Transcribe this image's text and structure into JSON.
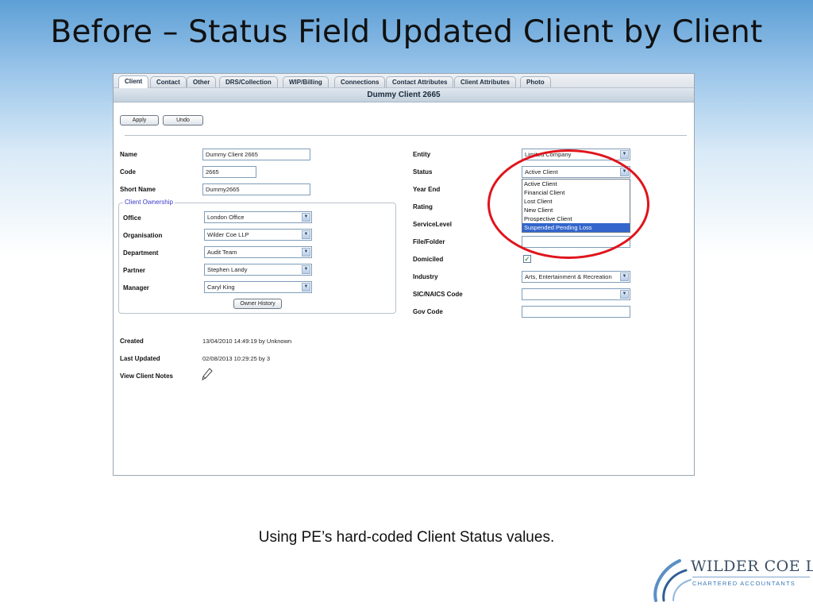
{
  "slide": {
    "title": "Before – Status Field Updated Client by Client",
    "caption": "Using PE’s hard-coded Client Status values."
  },
  "tabs": [
    "Client",
    "Contact",
    "Other",
    "DRS/Collection",
    "WIP/Billing",
    "Connections",
    "Contact Attributes",
    "Client Attributes",
    "Photo"
  ],
  "header": {
    "client_name": "Dummy Client 2665"
  },
  "toolbar": {
    "apply_label": "Apply",
    "undo_label": "Undo"
  },
  "left": {
    "name_label": "Name",
    "name_value": "Dummy Client 2665",
    "code_label": "Code",
    "code_value": "2665",
    "short_name_label": "Short Name",
    "short_name_value": "Dummy2665",
    "ownership_legend": "Client Ownership",
    "office_label": "Office",
    "office_value": "London Office",
    "organisation_label": "Organisation",
    "organisation_value": "Wilder Coe LLP",
    "department_label": "Department",
    "department_value": "Audit Team",
    "partner_label": "Partner",
    "partner_value": "Stephen Landy",
    "manager_label": "Manager",
    "manager_value": "Caryl King",
    "owner_history_label": "Owner History",
    "created_label": "Created",
    "created_value": "13/04/2010 14:49:19 by Unknown",
    "last_updated_label": "Last Updated",
    "last_updated_value": "02/08/2013 10:29:25 by 3",
    "view_notes_label": "View Client Notes"
  },
  "right": {
    "entity_label": "Entity",
    "entity_value": "Limited Company",
    "status_label": "Status",
    "status_value": "Active Client",
    "status_options": [
      "Active Client",
      "Financial Client",
      "Lost Client",
      "New Client",
      "Prospective Client",
      "Suspended Pending Loss"
    ],
    "year_end_label": "Year End",
    "rating_label": "Rating",
    "service_level_label": "ServiceLevel",
    "file_folder_label": "File/Folder",
    "domiciled_label": "Domiciled",
    "domiciled_checked": true,
    "industry_label": "Industry",
    "industry_value": "Arts, Entertainment & Recreation",
    "sic_label": "SIC/NAICS Code",
    "sic_value": "",
    "gov_code_label": "Gov Code",
    "gov_code_value": ""
  },
  "logo": {
    "name": "WILDER COE LLP",
    "tagline": "CHARTERED ACCOUNTANTS"
  },
  "colors": {
    "highlight_ring": "#e0141b",
    "selected_option": "#3366cc",
    "legend_text": "#3a3acb"
  }
}
